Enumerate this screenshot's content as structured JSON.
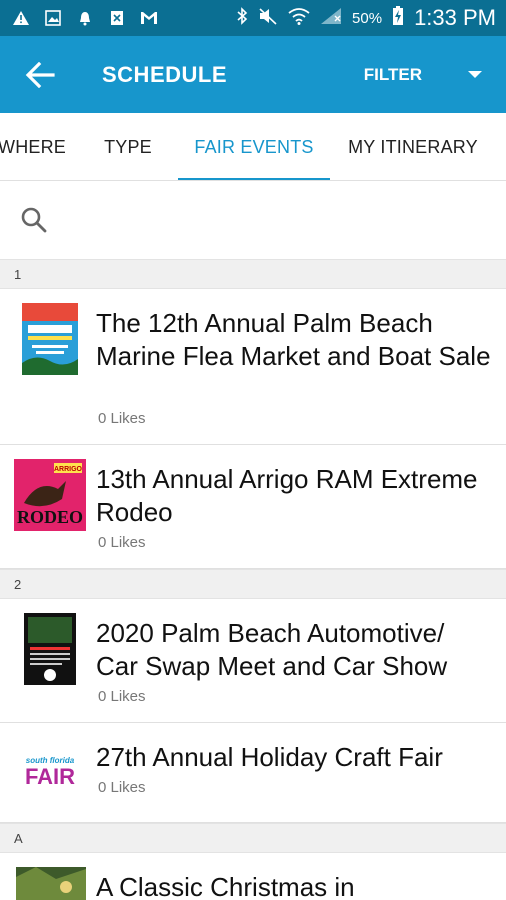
{
  "status": {
    "battery": "50%",
    "time": "1:33 PM"
  },
  "appbar": {
    "title": "SCHEDULE",
    "filter_label": "FILTER"
  },
  "tabs": [
    {
      "label": "WHERE"
    },
    {
      "label": "TYPE"
    },
    {
      "label": "FAIR EVENTS",
      "active": true
    },
    {
      "label": "MY ITINERARY"
    }
  ],
  "sections": [
    {
      "header": "1",
      "items": [
        {
          "title": "The 12th Annual Palm Beach Marine Flea Market and Boat Sale",
          "likes": "0 Likes"
        },
        {
          "title": "13th Annual Arrigo RAM Extreme Rodeo",
          "likes": "0 Likes"
        }
      ]
    },
    {
      "header": "2",
      "items": [
        {
          "title": "2020 Palm Beach Automotive/ Car Swap Meet and Car Show",
          "likes": "0 Likes"
        },
        {
          "title": "27th Annual Holiday Craft Fair",
          "likes": "0 Likes"
        }
      ]
    },
    {
      "header": "A",
      "items": [
        {
          "title": "A Classic Christmas in",
          "likes": ""
        }
      ]
    }
  ],
  "thumbs": {
    "rodeo_text": "RODEO",
    "rodeo_brand": "ARRIGO",
    "fair_small": "south florida",
    "fair_big": "FAIR"
  },
  "colors": {
    "status_bar": "#0b6f93",
    "app_bar": "#1796cc",
    "accent": "#1796cc"
  }
}
